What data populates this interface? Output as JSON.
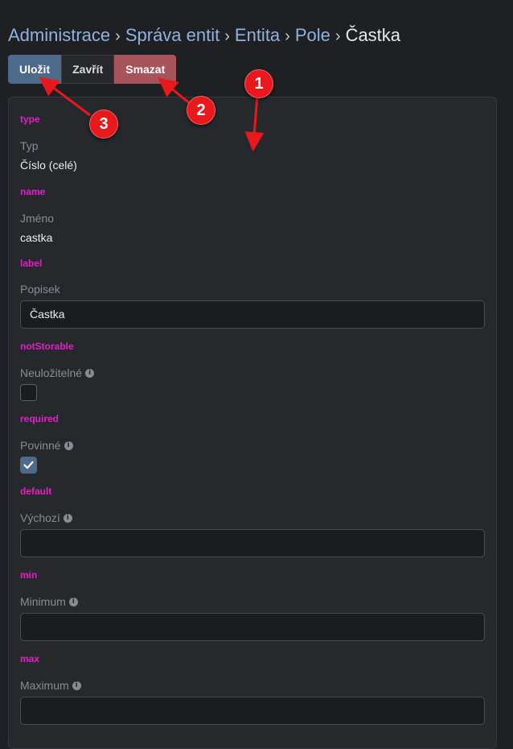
{
  "breadcrumb": {
    "items": [
      "Administrace",
      "Správa entit",
      "Entita",
      "Pole"
    ],
    "current": "Častka",
    "separator": "›"
  },
  "toolbar": {
    "save_label": "Uložit",
    "close_label": "Zavřít",
    "delete_label": "Smazat"
  },
  "fields": {
    "type": {
      "key": "type",
      "label": "Typ",
      "value": "Číslo (celé)"
    },
    "name": {
      "key": "name",
      "label": "Jméno",
      "value": "castka"
    },
    "label": {
      "key": "label",
      "label": "Popisek",
      "value": "Častka"
    },
    "notStorable": {
      "key": "notStorable",
      "label": "Neuložitelné",
      "checked": false
    },
    "required": {
      "key": "required",
      "label": "Povinné",
      "checked": true
    },
    "default": {
      "key": "default",
      "label": "Výchozí",
      "value": ""
    },
    "min": {
      "key": "min",
      "label": "Minimum",
      "value": ""
    },
    "max": {
      "key": "max",
      "label": "Maximum",
      "value": ""
    }
  },
  "annotations": {
    "marker_1": "1",
    "marker_2": "2",
    "marker_3": "3"
  },
  "icons": {
    "info": "info-circle-icon",
    "check": "checkmark-icon"
  },
  "colors": {
    "accent": "#4e6a8b",
    "danger": "#a6535b",
    "key_text": "#e020c8",
    "link": "#8fb3dc",
    "annotation": "#e8181c"
  }
}
